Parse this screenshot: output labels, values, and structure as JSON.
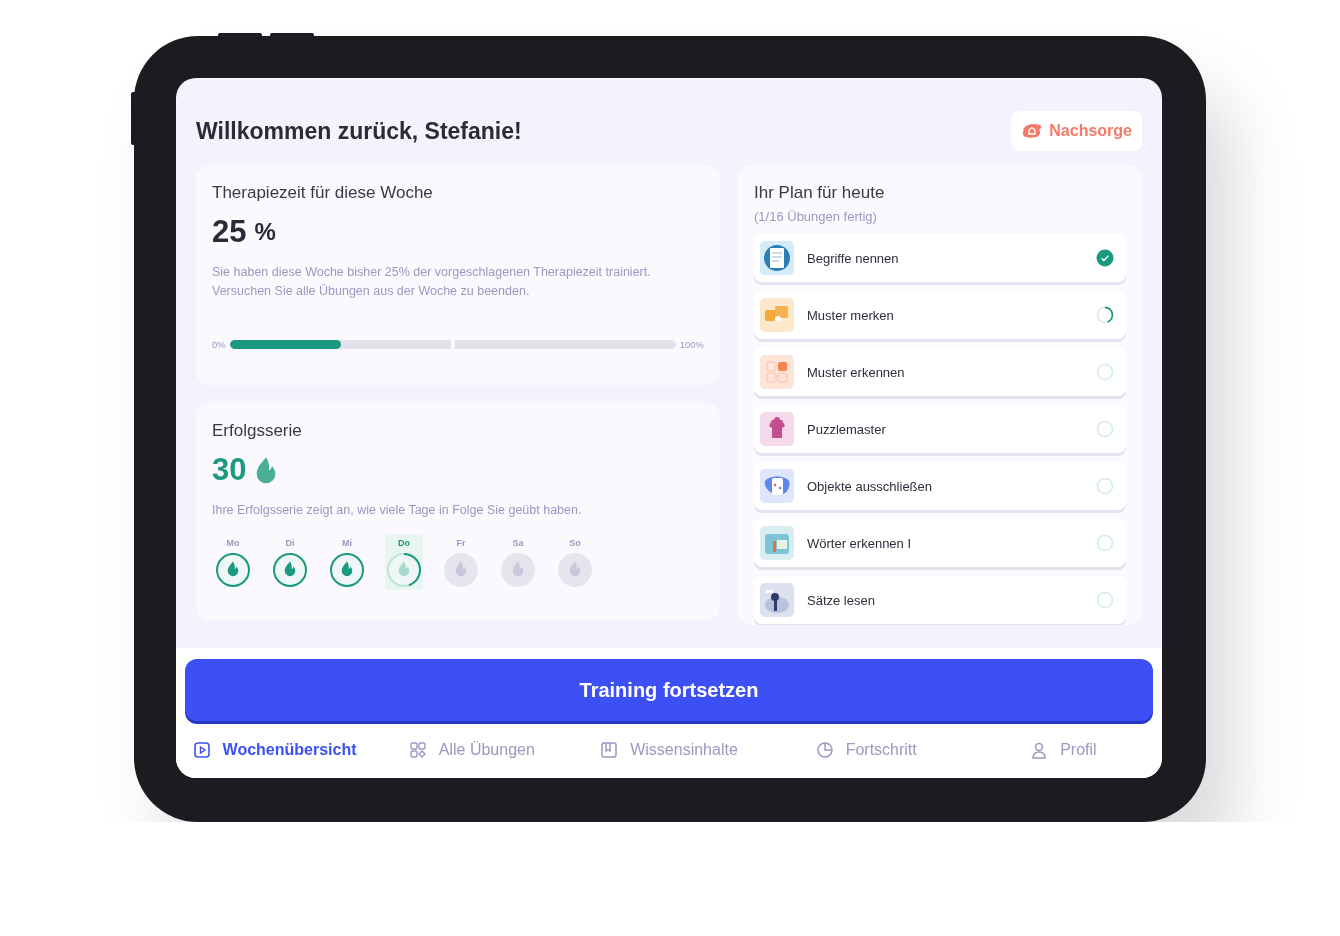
{
  "header": {
    "title": "Willkommen zurück, Stefanie!",
    "badge_button": "Nachsorge"
  },
  "therapy": {
    "title": "Therapiezeit für diese Woche",
    "value": "25",
    "unit": "%",
    "description": "Sie haben diese Woche bisher 25% der vorgeschlagenen Therapiezeit trainiert. Versuchen Sie alle Übungen aus der Woche zu beenden.",
    "progress": {
      "min_label": "0%",
      "max_label": "100%",
      "level": 0.25
    }
  },
  "streak": {
    "title": "Erfolgsserie",
    "value": "30",
    "description": "Ihre Erfolgsserie zeigt an, wie viele Tage in Folge Sie geübt haben.",
    "days": [
      {
        "label": "Mo",
        "kind": "done",
        "selected": false
      },
      {
        "label": "Di",
        "kind": "done",
        "selected": false
      },
      {
        "label": "Mi",
        "kind": "done",
        "selected": false
      },
      {
        "label": "Do",
        "kind": "today",
        "selected": true
      },
      {
        "label": "Fr",
        "kind": "upcoming",
        "selected": false
      },
      {
        "label": "Sa",
        "kind": "upcoming",
        "selected": false
      },
      {
        "label": "So",
        "kind": "upcoming",
        "selected": false
      }
    ]
  },
  "plan": {
    "title": "Ihr Plan für heute",
    "subtitle": "(1/16 Übungen fertig)",
    "items": [
      {
        "name": "Begriffe nennen",
        "kind": "done",
        "color": "#d4ecf8"
      },
      {
        "name": "Muster merken",
        "kind": "started",
        "color": "#fde8cc"
      },
      {
        "name": "Muster erkennen",
        "kind": "open",
        "color": "#fde3d8"
      },
      {
        "name": "Puzzlemaster",
        "kind": "open",
        "color": "#f3d9ea"
      },
      {
        "name": "Objekte ausschließen",
        "kind": "open",
        "color": "#dfe6fb"
      },
      {
        "name": "Wörter erkennen I",
        "kind": "open",
        "color": "#d9ecf0"
      },
      {
        "name": "Sätze lesen",
        "kind": "open",
        "color": "#dde0ee"
      }
    ]
  },
  "cta_button": "Training fortsetzen",
  "nav": [
    {
      "label": "Wochenübersicht",
      "selected": true
    },
    {
      "label": "Alle Übungen",
      "selected": false
    },
    {
      "label": "Wissensinhalte",
      "selected": false
    },
    {
      "label": "Fortschritt",
      "selected": false
    },
    {
      "label": "Profil",
      "selected": false
    }
  ]
}
